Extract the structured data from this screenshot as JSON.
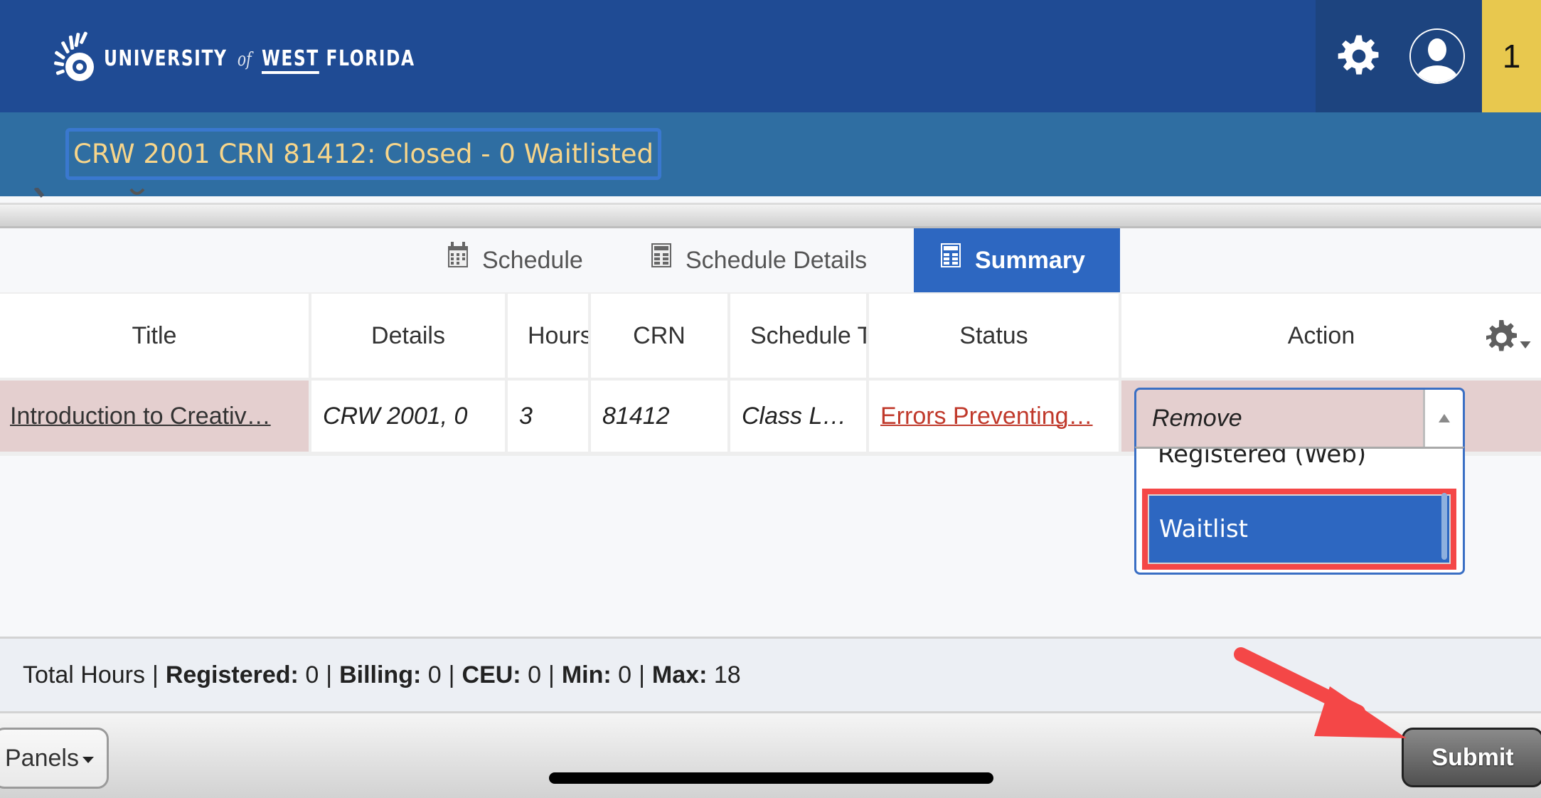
{
  "header": {
    "logo": {
      "word1": "UNIVERSITY",
      "of": "of",
      "word2": "WEST",
      "word3": "FLORIDA",
      "icon": "nautilus-shell-logo"
    },
    "tools": {
      "settings_icon": "gear-icon",
      "profile_icon": "user-avatar-icon",
      "notification_count": "1"
    },
    "colors": {
      "header_bg": "#1f4b94",
      "tools_bg": "#1d447f",
      "badge_bg": "#e8c84e"
    }
  },
  "notice": {
    "message": "CRW 2001 CRN 81412: Closed - 0 Waitlisted",
    "colors": {
      "bg": "#2f6ea2",
      "text": "#f7d58a",
      "focus_border": "#3a78cf"
    }
  },
  "tabs": [
    {
      "label": "Schedule",
      "icon": "calendar-icon",
      "active": false
    },
    {
      "label": "Schedule Details",
      "icon": "table-icon",
      "active": false
    },
    {
      "label": "Summary",
      "icon": "calculator-icon",
      "active": true
    }
  ],
  "table": {
    "columns": [
      "Title",
      "Details",
      "Hours",
      "CRN",
      "Schedule Type",
      "Status",
      "Action"
    ],
    "column_display": [
      "Title",
      "Details",
      "Hours",
      "CRN",
      "Schedule T",
      "Status",
      "Action"
    ],
    "settings_icon": "gear-dropdown-icon",
    "rows": [
      {
        "title": "Introduction to Creativ…",
        "details": "CRW 2001, 0",
        "hours": "3",
        "crn": "81412",
        "schedule_type": "Class L…",
        "status": "Errors Preventing…",
        "action": "Remove"
      }
    ]
  },
  "action_dropdown": {
    "selected": "Remove",
    "options": [
      "Registered (Web)",
      "Waitlist"
    ],
    "highlighted": "Waitlist"
  },
  "totals": {
    "label": "Total Hours",
    "registered_label": "Registered:",
    "registered": "0",
    "billing_label": "Billing:",
    "billing": "0",
    "ceu_label": "CEU:",
    "ceu": "0",
    "min_label": "Min:",
    "min": "0",
    "max_label": "Max:",
    "max": "18"
  },
  "footer": {
    "panels_label": "Panels",
    "submit_label": "Submit"
  },
  "annotation": {
    "color": "#f44747",
    "target": "Submit"
  }
}
